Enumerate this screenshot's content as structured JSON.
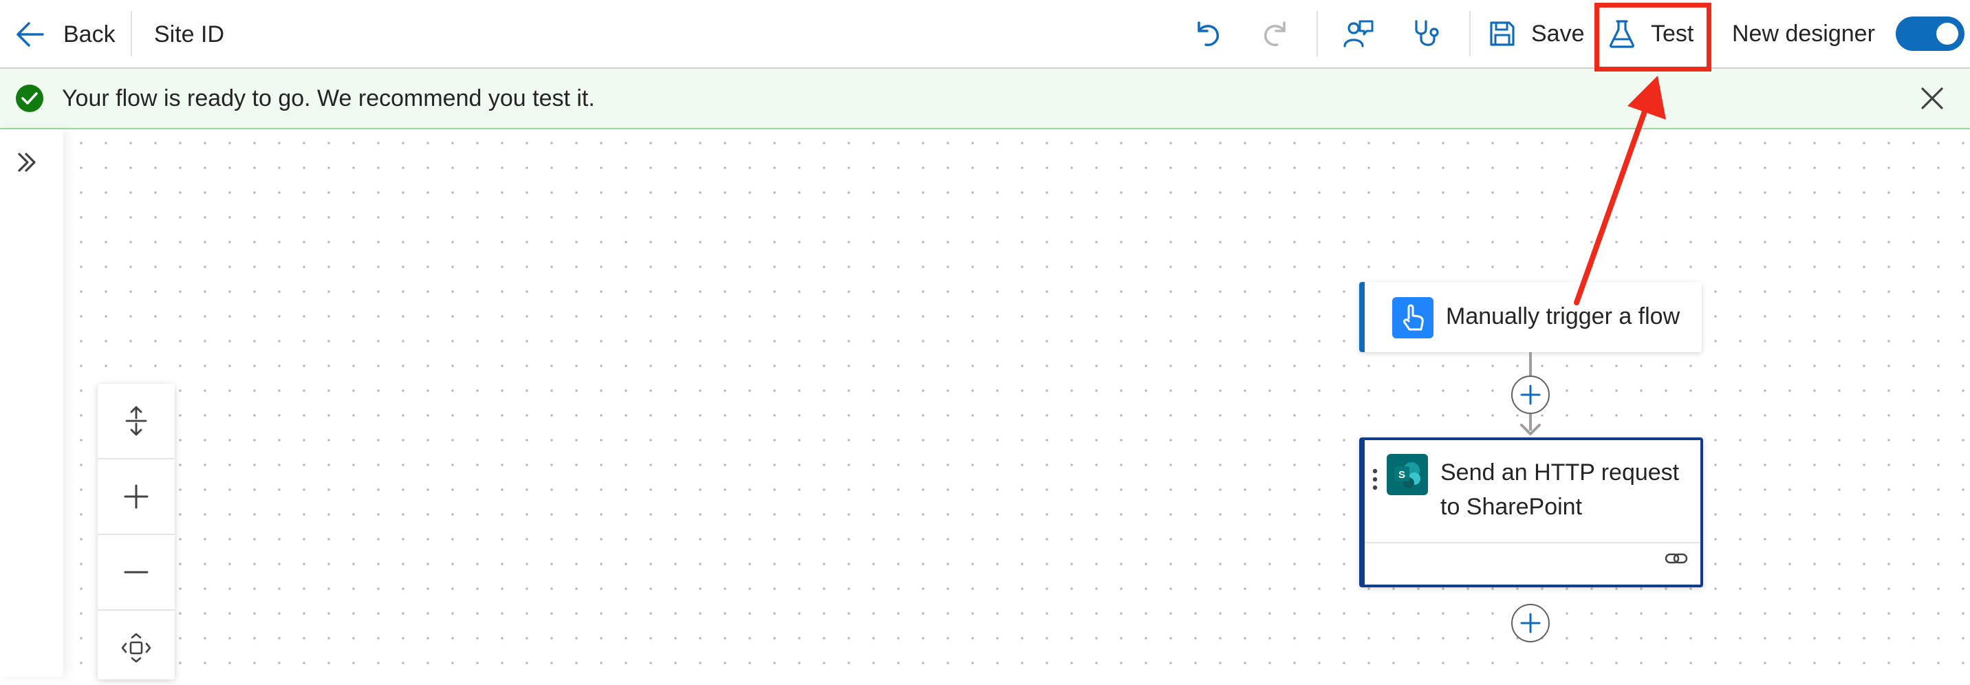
{
  "header": {
    "back_label": "Back",
    "flow_title": "Site ID",
    "save_label": "Save",
    "test_label": "Test",
    "new_designer_label": "New designer",
    "new_designer_on": true
  },
  "notification": {
    "message": "Your flow is ready to go. We recommend you test it.",
    "status": "success"
  },
  "flow": {
    "trigger": {
      "label": "Manually trigger a flow",
      "icon": "touch-hand-icon"
    },
    "action": {
      "label": "Send an HTTP request to SharePoint",
      "icon": "sharepoint-icon",
      "icon_letter": "S"
    }
  },
  "colors": {
    "accent": "#0f6cbd",
    "trigger_icon_bg": "#1f85ff",
    "sharepoint_bg": "#036c70",
    "success_bg": "#f1faf1",
    "success_icon": "#107c10",
    "annotation_red": "#f02a1a"
  }
}
